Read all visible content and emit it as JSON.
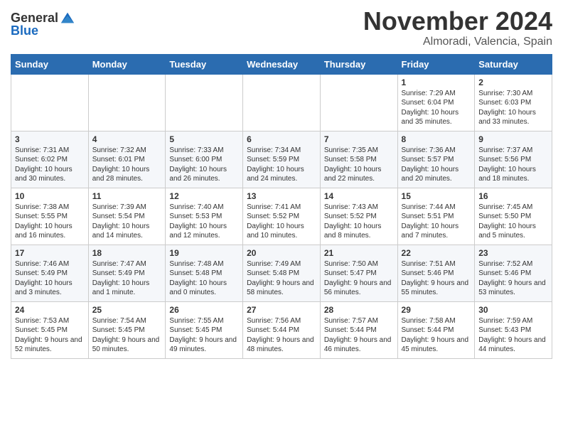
{
  "header": {
    "logo_general": "General",
    "logo_blue": "Blue",
    "month": "November 2024",
    "location": "Almoradi, Valencia, Spain"
  },
  "days_of_week": [
    "Sunday",
    "Monday",
    "Tuesday",
    "Wednesday",
    "Thursday",
    "Friday",
    "Saturday"
  ],
  "weeks": [
    [
      {
        "day": "",
        "info": ""
      },
      {
        "day": "",
        "info": ""
      },
      {
        "day": "",
        "info": ""
      },
      {
        "day": "",
        "info": ""
      },
      {
        "day": "",
        "info": ""
      },
      {
        "day": "1",
        "info": "Sunrise: 7:29 AM\nSunset: 6:04 PM\nDaylight: 10 hours and 35 minutes."
      },
      {
        "day": "2",
        "info": "Sunrise: 7:30 AM\nSunset: 6:03 PM\nDaylight: 10 hours and 33 minutes."
      }
    ],
    [
      {
        "day": "3",
        "info": "Sunrise: 7:31 AM\nSunset: 6:02 PM\nDaylight: 10 hours and 30 minutes."
      },
      {
        "day": "4",
        "info": "Sunrise: 7:32 AM\nSunset: 6:01 PM\nDaylight: 10 hours and 28 minutes."
      },
      {
        "day": "5",
        "info": "Sunrise: 7:33 AM\nSunset: 6:00 PM\nDaylight: 10 hours and 26 minutes."
      },
      {
        "day": "6",
        "info": "Sunrise: 7:34 AM\nSunset: 5:59 PM\nDaylight: 10 hours and 24 minutes."
      },
      {
        "day": "7",
        "info": "Sunrise: 7:35 AM\nSunset: 5:58 PM\nDaylight: 10 hours and 22 minutes."
      },
      {
        "day": "8",
        "info": "Sunrise: 7:36 AM\nSunset: 5:57 PM\nDaylight: 10 hours and 20 minutes."
      },
      {
        "day": "9",
        "info": "Sunrise: 7:37 AM\nSunset: 5:56 PM\nDaylight: 10 hours and 18 minutes."
      }
    ],
    [
      {
        "day": "10",
        "info": "Sunrise: 7:38 AM\nSunset: 5:55 PM\nDaylight: 10 hours and 16 minutes."
      },
      {
        "day": "11",
        "info": "Sunrise: 7:39 AM\nSunset: 5:54 PM\nDaylight: 10 hours and 14 minutes."
      },
      {
        "day": "12",
        "info": "Sunrise: 7:40 AM\nSunset: 5:53 PM\nDaylight: 10 hours and 12 minutes."
      },
      {
        "day": "13",
        "info": "Sunrise: 7:41 AM\nSunset: 5:52 PM\nDaylight: 10 hours and 10 minutes."
      },
      {
        "day": "14",
        "info": "Sunrise: 7:43 AM\nSunset: 5:52 PM\nDaylight: 10 hours and 8 minutes."
      },
      {
        "day": "15",
        "info": "Sunrise: 7:44 AM\nSunset: 5:51 PM\nDaylight: 10 hours and 7 minutes."
      },
      {
        "day": "16",
        "info": "Sunrise: 7:45 AM\nSunset: 5:50 PM\nDaylight: 10 hours and 5 minutes."
      }
    ],
    [
      {
        "day": "17",
        "info": "Sunrise: 7:46 AM\nSunset: 5:49 PM\nDaylight: 10 hours and 3 minutes."
      },
      {
        "day": "18",
        "info": "Sunrise: 7:47 AM\nSunset: 5:49 PM\nDaylight: 10 hours and 1 minute."
      },
      {
        "day": "19",
        "info": "Sunrise: 7:48 AM\nSunset: 5:48 PM\nDaylight: 10 hours and 0 minutes."
      },
      {
        "day": "20",
        "info": "Sunrise: 7:49 AM\nSunset: 5:48 PM\nDaylight: 9 hours and 58 minutes."
      },
      {
        "day": "21",
        "info": "Sunrise: 7:50 AM\nSunset: 5:47 PM\nDaylight: 9 hours and 56 minutes."
      },
      {
        "day": "22",
        "info": "Sunrise: 7:51 AM\nSunset: 5:46 PM\nDaylight: 9 hours and 55 minutes."
      },
      {
        "day": "23",
        "info": "Sunrise: 7:52 AM\nSunset: 5:46 PM\nDaylight: 9 hours and 53 minutes."
      }
    ],
    [
      {
        "day": "24",
        "info": "Sunrise: 7:53 AM\nSunset: 5:45 PM\nDaylight: 9 hours and 52 minutes."
      },
      {
        "day": "25",
        "info": "Sunrise: 7:54 AM\nSunset: 5:45 PM\nDaylight: 9 hours and 50 minutes."
      },
      {
        "day": "26",
        "info": "Sunrise: 7:55 AM\nSunset: 5:45 PM\nDaylight: 9 hours and 49 minutes."
      },
      {
        "day": "27",
        "info": "Sunrise: 7:56 AM\nSunset: 5:44 PM\nDaylight: 9 hours and 48 minutes."
      },
      {
        "day": "28",
        "info": "Sunrise: 7:57 AM\nSunset: 5:44 PM\nDaylight: 9 hours and 46 minutes."
      },
      {
        "day": "29",
        "info": "Sunrise: 7:58 AM\nSunset: 5:44 PM\nDaylight: 9 hours and 45 minutes."
      },
      {
        "day": "30",
        "info": "Sunrise: 7:59 AM\nSunset: 5:43 PM\nDaylight: 9 hours and 44 minutes."
      }
    ]
  ]
}
